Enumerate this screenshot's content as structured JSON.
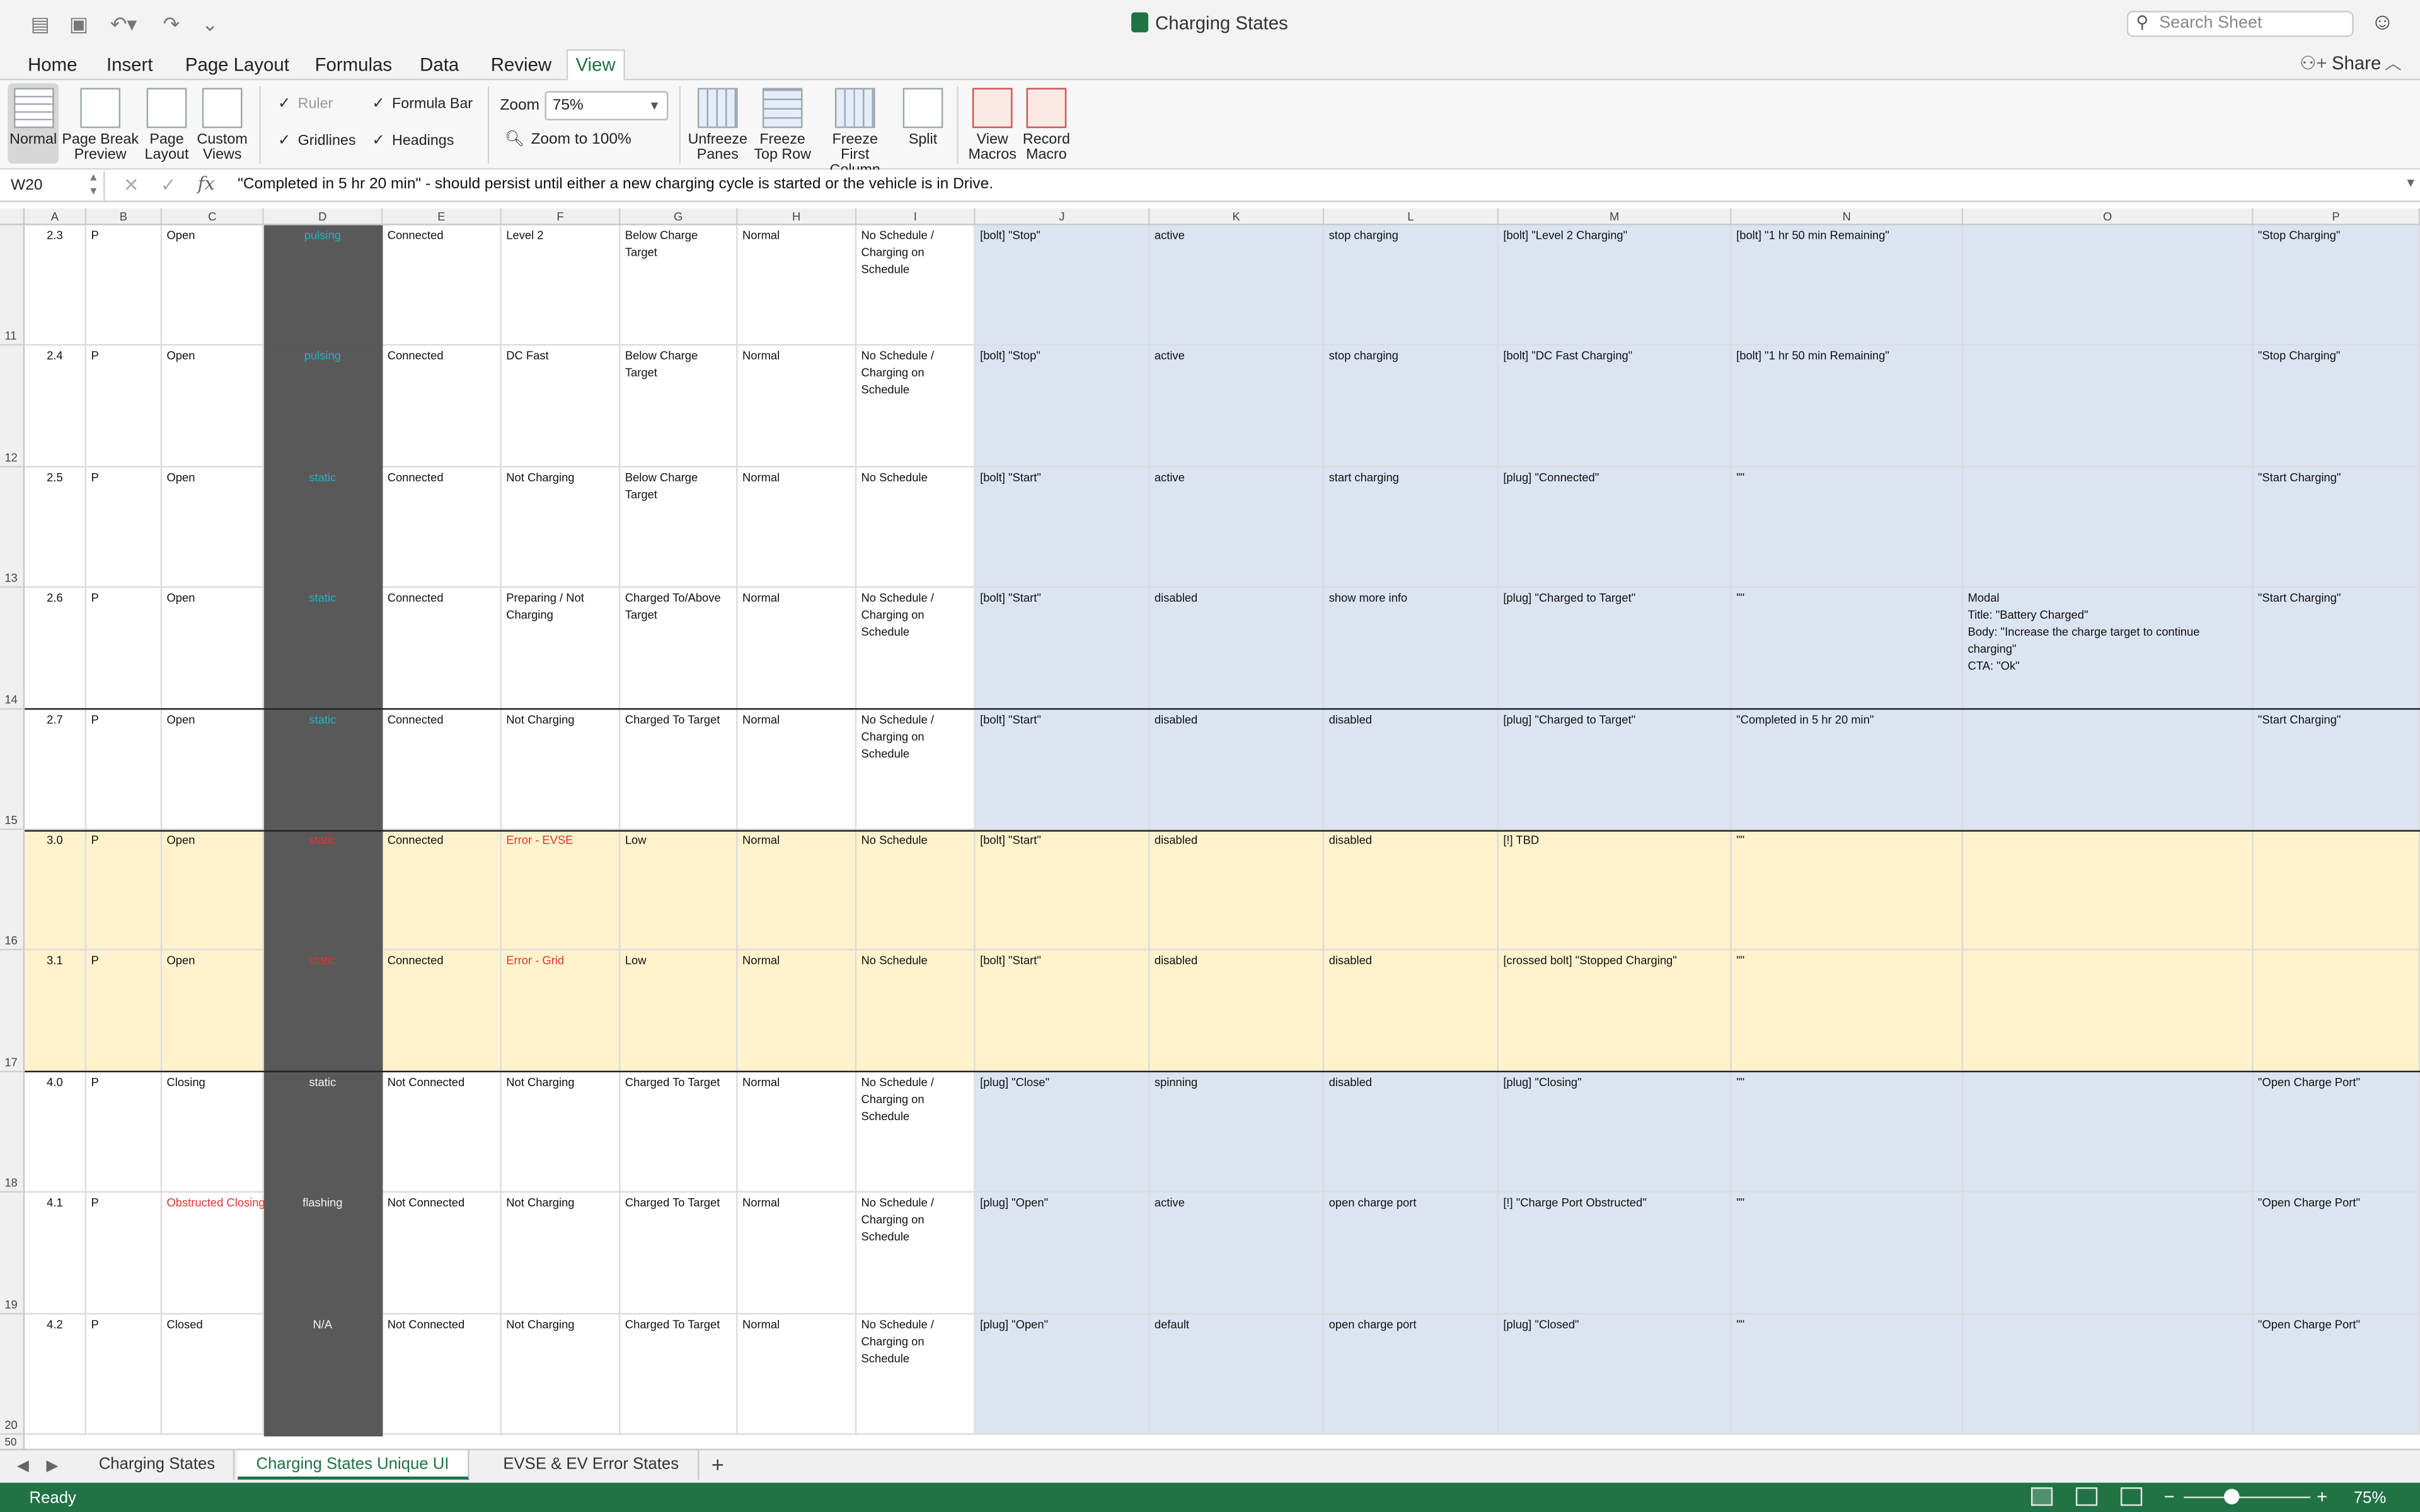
{
  "window": {
    "title": "Charging States",
    "search_placeholder": "Search Sheet"
  },
  "ribbon_tabs": [
    "Home",
    "Insert",
    "Page Layout",
    "Formulas",
    "Data",
    "Review",
    "View"
  ],
  "active_tab": "View",
  "share_label": "Share",
  "view_buttons": [
    {
      "label1": "Normal",
      "label2": ""
    },
    {
      "label1": "Page Break",
      "label2": "Preview"
    },
    {
      "label1": "Page",
      "label2": "Layout"
    },
    {
      "label1": "Custom",
      "label2": "Views"
    }
  ],
  "show_options": {
    "ruler": "Ruler",
    "formula_bar": "Formula Bar",
    "gridlines": "Gridlines",
    "headings": "Headings"
  },
  "zoom": {
    "label": "Zoom",
    "value": "75%",
    "zoom100": "Zoom to 100%"
  },
  "window_buttons": [
    {
      "label1": "Unfreeze",
      "label2": "Panes"
    },
    {
      "label1": "Freeze",
      "label2": "Top Row"
    },
    {
      "label1": "Freeze First",
      "label2": "Column"
    },
    {
      "label1": "Split",
      "label2": ""
    }
  ],
  "macro_buttons": [
    {
      "label1": "View",
      "label2": "Macros"
    },
    {
      "label1": "Record",
      "label2": "Macro"
    }
  ],
  "formula_bar": {
    "name_box": "W20",
    "fx": "fx",
    "formula": "\"Completed in 5 hr 20 min\" - should persist until either a new charging cycle is started or the vehicle is in Drive."
  },
  "columns": [
    "A",
    "B",
    "C",
    "D",
    "E",
    "F",
    "G",
    "H",
    "I",
    "J",
    "K",
    "L",
    "M",
    "N",
    "O",
    "P"
  ],
  "row_numbers": [
    "11",
    "12",
    "13",
    "14",
    "15",
    "16",
    "17",
    "18",
    "19",
    "20"
  ],
  "last_row_number": "50",
  "rows": [
    {
      "a": "2.3",
      "b": "P",
      "c": "Open",
      "d": "pulsing",
      "e": "Connected",
      "f": "Level 2",
      "g": "Below Charge Target",
      "h": "Normal",
      "i": "No Schedule / Charging on Schedule",
      "j": "[bolt] \"Stop\"",
      "k": "active",
      "l": "stop charging",
      "m": "[bolt] \"Level 2 Charging\"",
      "n": "[bolt] \"1 hr 50 min Remaining\"",
      "o": "",
      "p": "\"Stop Charging\""
    },
    {
      "a": "2.4",
      "b": "P",
      "c": "Open",
      "d": "pulsing",
      "e": "Connected",
      "f": "DC Fast",
      "g": "Below Charge Target",
      "h": "Normal",
      "i": "No Schedule / Charging on Schedule",
      "j": "[bolt] \"Stop\"",
      "k": "active",
      "l": "stop charging",
      "m": "[bolt] \"DC Fast Charging\"",
      "n": "[bolt] \"1 hr 50 min Remaining\"",
      "o": "",
      "p": "\"Stop Charging\""
    },
    {
      "a": "2.5",
      "b": "P",
      "c": "Open",
      "d": "static",
      "e": "Connected",
      "f": "Not Charging",
      "g": "Below Charge Target",
      "h": "Normal",
      "i": "No Schedule",
      "j": "[bolt] \"Start\"",
      "k": "active",
      "l": "start charging",
      "m": "[plug] \"Connected\"",
      "n": "\"\"",
      "o": "",
      "p": "\"Start Charging\""
    },
    {
      "a": "2.6",
      "b": "P",
      "c": "Open",
      "d": "static",
      "e": "Connected",
      "f": "Preparing / Not Charging",
      "g": "Charged To/Above Target",
      "h": "Normal",
      "i": "No Schedule / Charging on Schedule",
      "j": "[bolt] \"Start\"",
      "k": "disabled",
      "l": "show more info",
      "m": "[plug] \"Charged to Target\"",
      "n": "\"\"",
      "o": "Modal\nTitle: \"Battery Charged\"\nBody: \"Increase the charge target to continue charging\"\nCTA: \"Ok\"",
      "p": "\"Start Charging\""
    },
    {
      "a": "2.7",
      "b": "P",
      "c": "Open",
      "d": "static",
      "e": "Connected",
      "f": "Not Charging",
      "g": "Charged To Target",
      "h": "Normal",
      "i": "No Schedule / Charging on Schedule",
      "j": "[bolt] \"Start\"",
      "k": "disabled",
      "l": "disabled",
      "m": "[plug] \"Charged to Target\"",
      "n": "\"Completed in 5 hr 20 min\"",
      "o": "",
      "p": "\"Start Charging\""
    },
    {
      "a": "3.0",
      "b": "P",
      "c": "Open",
      "d": "static",
      "e": "Connected",
      "f": "Error - EVSE",
      "g": "Low",
      "h": "Normal",
      "i": "No Schedule",
      "j": "[bolt] \"Start\"",
      "k": "disabled",
      "l": "disabled",
      "m": "[!] TBD",
      "n": "\"\"",
      "o": "",
      "p": ""
    },
    {
      "a": "3.1",
      "b": "P",
      "c": "Open",
      "d": "static",
      "e": "Connected",
      "f": "Error - Grid",
      "g": "Low",
      "h": "Normal",
      "i": "No Schedule",
      "j": "[bolt] \"Start\"",
      "k": "disabled",
      "l": "disabled",
      "m": "[crossed bolt] \"Stopped Charging\"",
      "n": "\"\"",
      "o": "",
      "p": ""
    },
    {
      "a": "4.0",
      "b": "P",
      "c": "Closing",
      "d": "static",
      "e": "Not Connected",
      "f": "Not Charging",
      "g": "Charged To Target",
      "h": "Normal",
      "i": "No Schedule / Charging on Schedule",
      "j": "[plug] \"Close\"",
      "k": "spinning",
      "l": "disabled",
      "m": "[plug] \"Closing\"",
      "n": "\"\"",
      "o": "",
      "p": "\"Open Charge Port\""
    },
    {
      "a": "4.1",
      "b": "P",
      "c": "Obstructed Closing",
      "d": "flashing",
      "e": "Not Connected",
      "f": "Not Charging",
      "g": "Charged To Target",
      "h": "Normal",
      "i": "No Schedule / Charging on Schedule",
      "j": "[plug] \"Open\"",
      "k": "active",
      "l": "open charge port",
      "m": "[!] \"Charge Port Obstructed\"",
      "n": "\"\"",
      "o": "",
      "p": "\"Open Charge Port\""
    },
    {
      "a": "4.2",
      "b": "P",
      "c": "Closed",
      "d": "N/A",
      "e": "Not Connected",
      "f": "Not Charging",
      "g": "Charged To Target",
      "h": "Normal",
      "i": "No Schedule / Charging on Schedule",
      "j": "[plug] \"Open\"",
      "k": "default",
      "l": "open charge port",
      "m": "[plug] \"Closed\"",
      "n": "\"\"",
      "o": "",
      "p": "\"Open Charge Port\""
    }
  ],
  "colors": {
    "blue_band": "#dbe4f1",
    "yellow_band": "#fff2cc",
    "dark_column": "#595959",
    "excel_green": "#217346",
    "cyan_text": "#22b2c4",
    "red_text": "#e33434"
  },
  "sheet_tabs": [
    "Charging States",
    "Charging States Unique UI",
    "EVSE & EV Error States"
  ],
  "active_sheet": "Charging States Unique UI",
  "status": {
    "ready": "Ready",
    "zoom": "75%"
  }
}
